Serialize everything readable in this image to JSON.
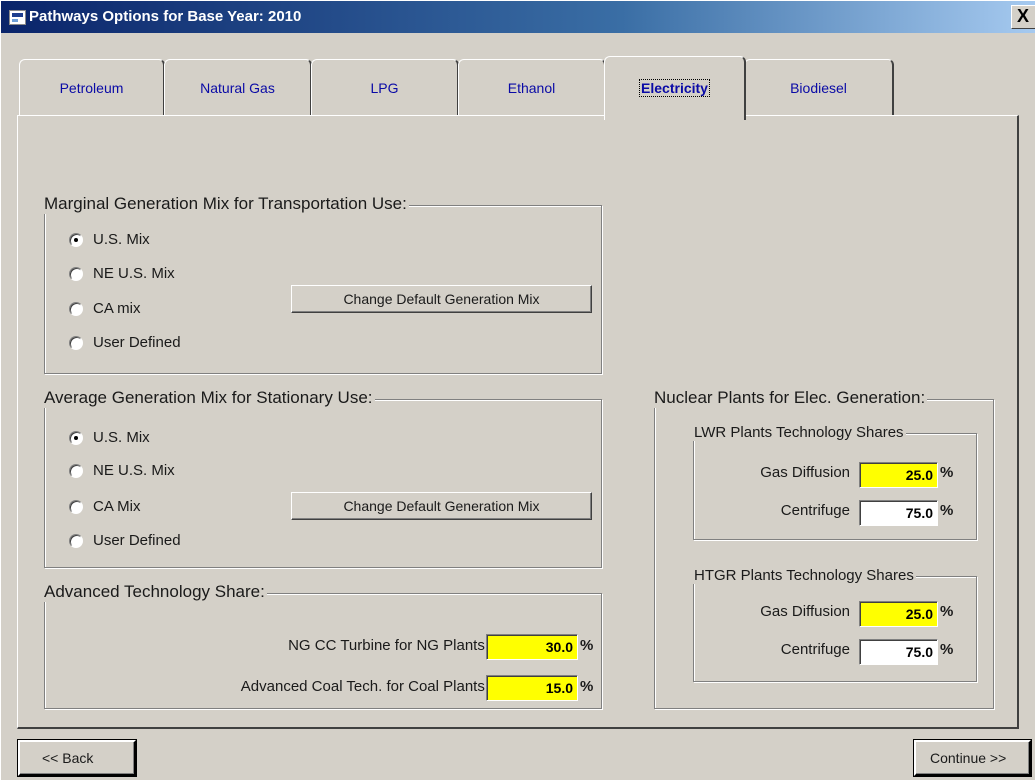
{
  "window": {
    "title": "Pathways Options for Base Year: 2010",
    "close_glyph": "X"
  },
  "tabs": [
    {
      "label": "Petroleum"
    },
    {
      "label": "Natural Gas"
    },
    {
      "label": "LPG"
    },
    {
      "label": "Ethanol"
    },
    {
      "label": "Electricity",
      "active": true
    },
    {
      "label": "Biodiesel"
    }
  ],
  "marginal_mix": {
    "title": "Marginal Generation Mix for Transportation Use:",
    "options": [
      "U.S. Mix",
      "NE U.S. Mix",
      "CA mix",
      "User Defined"
    ],
    "selected": "U.S. Mix",
    "button_label": "Change Default Generation Mix"
  },
  "average_mix": {
    "title": "Average Generation Mix for Stationary Use:",
    "options": [
      "U.S. Mix",
      "NE U.S. Mix",
      "CA Mix",
      "User Defined"
    ],
    "selected": "U.S. Mix",
    "button_label": "Change Default Generation Mix"
  },
  "advanced_tech": {
    "title": "Advanced Technology Share:",
    "ng_label": "NG CC Turbine for NG Plants:",
    "ng_value": "30.0",
    "coal_label": "Advanced Coal Tech. for Coal Plants:",
    "coal_value": "15.0",
    "unit": "%"
  },
  "nuclear": {
    "title": "Nuclear Plants for Elec. Generation:",
    "lwr": {
      "title": "LWR Plants Technology Shares",
      "gas_diffusion_label": "Gas Diffusion",
      "gas_diffusion_value": "25.0",
      "centrifuge_label": "Centrifuge",
      "centrifuge_value": "75.0"
    },
    "htgr": {
      "title": "HTGR Plants Technology Shares",
      "gas_diffusion_label": "Gas Diffusion",
      "gas_diffusion_value": "25.0",
      "centrifuge_label": "Centrifuge",
      "centrifuge_value": "75.0"
    },
    "unit": "%"
  },
  "nav": {
    "back_label": "<< Back",
    "continue_label": "Continue >>"
  },
  "colors": {
    "highlight_field": "#ffff00",
    "title_bar": "#0a246a",
    "tab_text": "#0a0aa6"
  }
}
